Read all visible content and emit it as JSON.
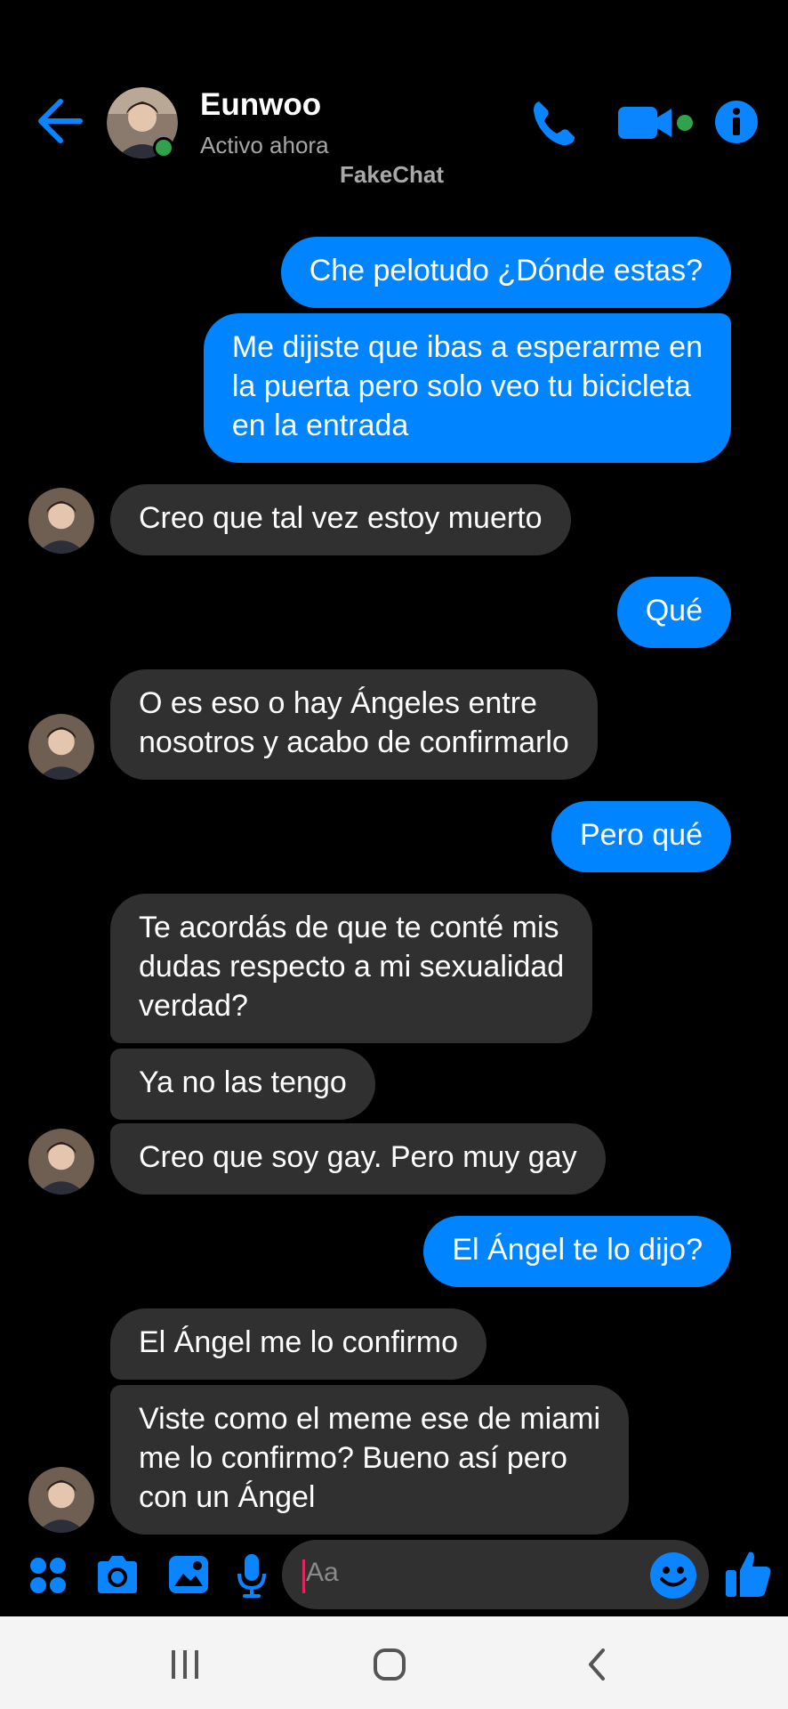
{
  "header": {
    "contact_name": "Eunwoo",
    "status": "Activo ahora",
    "watermark": "FakeChat",
    "back_icon": "arrow-left-icon",
    "phone_icon": "phone-icon",
    "video_icon": "video-camera-icon",
    "info_icon": "info-icon"
  },
  "messages": [
    {
      "from": "me",
      "text": "Che pelotudo ¿Dónde estas?"
    },
    {
      "from": "me",
      "lines": [
        "Me dijiste que ibas a esperarme en",
        "la puerta pero solo veo tu bicicleta",
        "en la entrada"
      ]
    },
    {
      "from": "them",
      "text": "Creo que tal vez estoy muerto"
    },
    {
      "from": "me",
      "text": "Qué"
    },
    {
      "from": "them",
      "lines": [
        "O es eso o hay Ángeles entre",
        "nosotros y acabo de confirmarlo"
      ]
    },
    {
      "from": "me",
      "text": "Pero qué"
    },
    {
      "from": "them",
      "lines": [
        "Te acordás de que te conté mis",
        "dudas respecto a mi sexualidad",
        "verdad?"
      ]
    },
    {
      "from": "them",
      "text": "Ya no las tengo"
    },
    {
      "from": "them",
      "text": "Creo que soy gay. Pero muy gay"
    },
    {
      "from": "me",
      "text": "El Ángel te lo dijo?"
    },
    {
      "from": "them",
      "text": "El Ángel me lo confirmo"
    },
    {
      "from": "them",
      "lines": [
        "Viste como el meme ese de miami",
        "me lo confirmo? Bueno así pero",
        "con un Ángel"
      ]
    }
  ],
  "composer": {
    "placeholder": "Aa",
    "icons": [
      "apps-icon",
      "camera-icon",
      "image-icon",
      "microphone-icon",
      "emoji-icon",
      "thumbs-up-icon"
    ]
  },
  "navbar": {
    "icons": [
      "recent-apps-icon",
      "home-icon",
      "back-icon"
    ]
  },
  "colors": {
    "accent": "#0084ff",
    "received_bubble": "#303030",
    "background": "#000000",
    "online": "#31a24c"
  }
}
